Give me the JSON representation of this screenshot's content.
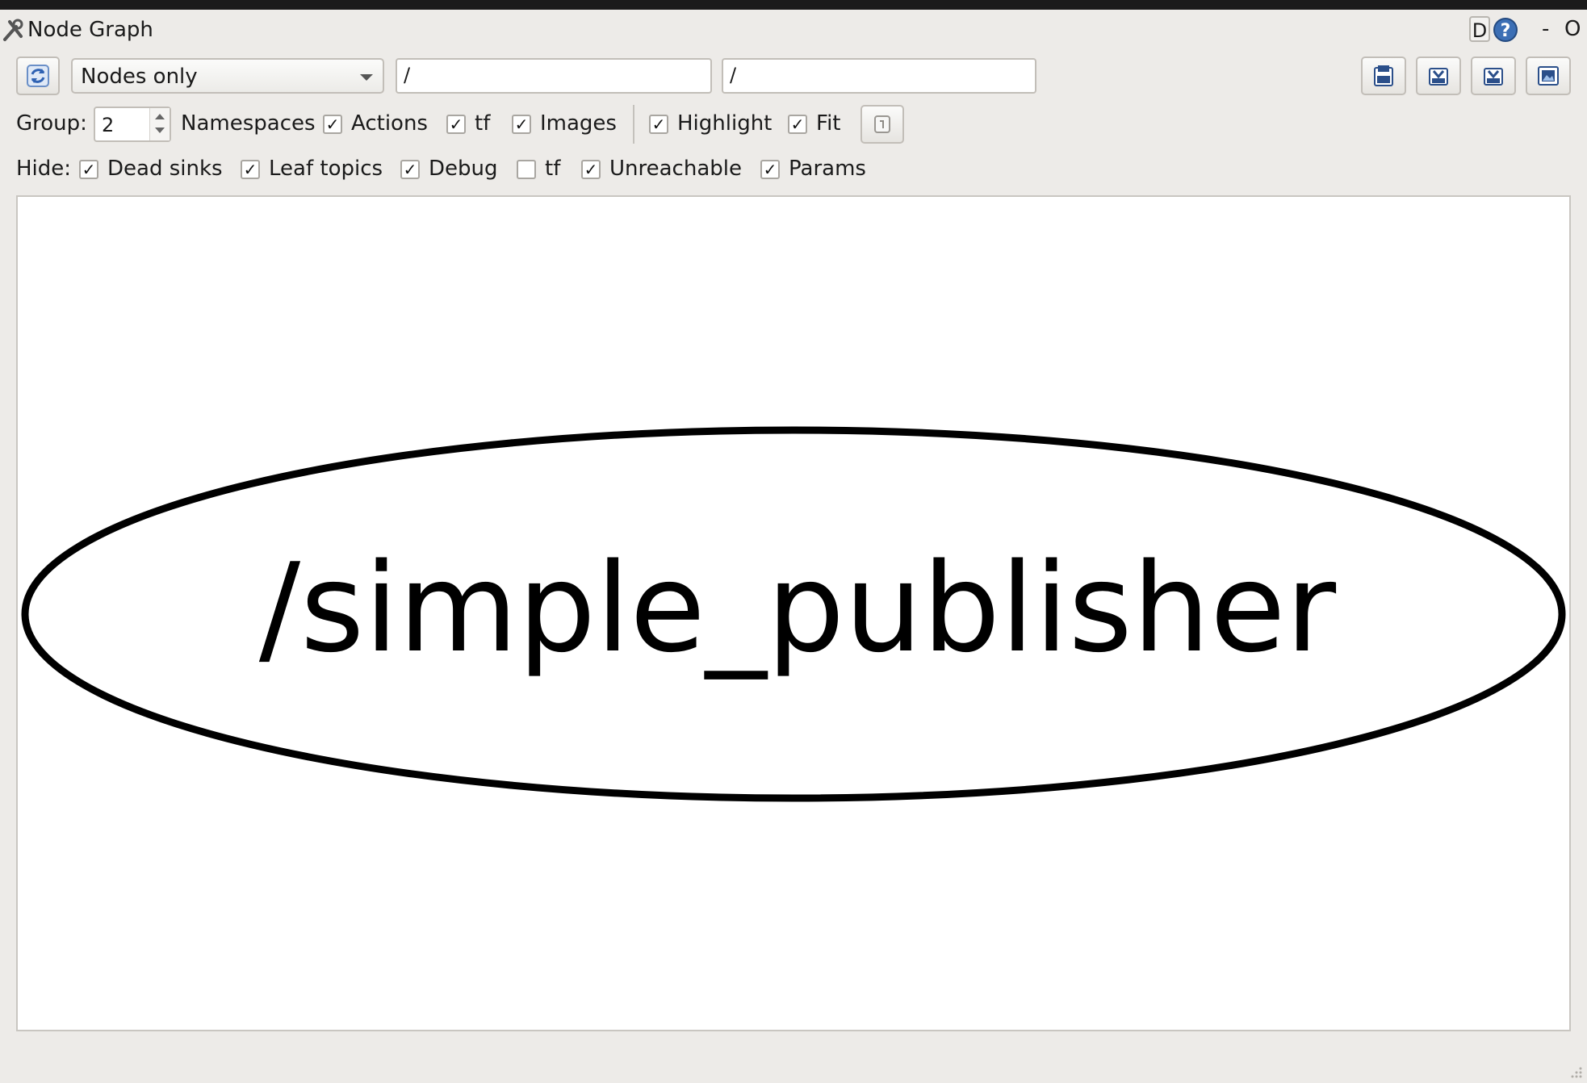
{
  "window": {
    "title": "Node Graph",
    "d_button": "D",
    "title_dash": "-",
    "title_o": "O"
  },
  "toolbar": {
    "mode_selected": "Nodes only",
    "node_filter": "/",
    "topic_filter": "/",
    "icons": [
      "refresh-icon",
      "load-icon",
      "save-dot-icon",
      "save-svg-icon",
      "save-image-icon"
    ]
  },
  "options": {
    "group_label": "Group:",
    "group_value": "2",
    "namespaces": {
      "label": "Namespaces",
      "checked": true
    },
    "actions": {
      "label": "Actions",
      "checked": true
    },
    "tf": {
      "label": "tf",
      "checked": true
    },
    "images": {
      "label": "Images",
      "checked": true
    },
    "highlight": {
      "label": "Highlight",
      "checked": true
    },
    "fit": {
      "label": "Fit",
      "checked": true
    }
  },
  "hide": {
    "label": "Hide:",
    "dead_sinks": {
      "label": "Dead sinks",
      "checked": true
    },
    "leaf_topics": {
      "label": "Leaf topics",
      "checked": true
    },
    "debug": {
      "label": "Debug",
      "checked": true
    },
    "tf": {
      "label": "tf",
      "checked": false
    },
    "unreachable": {
      "label": "Unreachable",
      "checked": true
    },
    "params": {
      "label": "Params",
      "checked": true
    }
  },
  "graph": {
    "nodes": [
      {
        "label": "/simple_publisher"
      }
    ]
  }
}
